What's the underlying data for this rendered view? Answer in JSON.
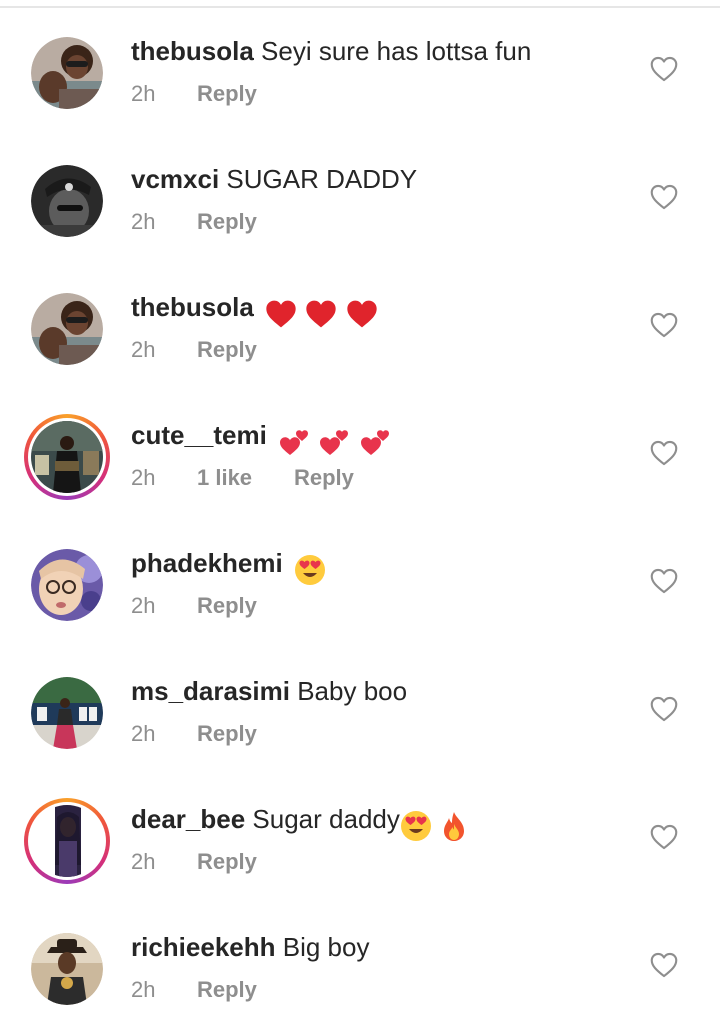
{
  "comments": [
    {
      "username": "thebusola",
      "text": "Seyi sure has lottsa fun",
      "time": "2h",
      "likes": "",
      "reply_label": "Reply",
      "has_story": false,
      "avatar": "avatar-woman-glasses",
      "emojis": []
    },
    {
      "username": "vcmxci",
      "text": "SUGAR DADDY",
      "time": "2h",
      "likes": "",
      "reply_label": "Reply",
      "has_story": false,
      "avatar": "avatar-man-cap-bw",
      "emojis": []
    },
    {
      "username": "thebusola",
      "text": "",
      "time": "2h",
      "likes": "",
      "reply_label": "Reply",
      "has_story": false,
      "avatar": "avatar-woman-glasses",
      "emojis": [
        "red-heart",
        "red-heart",
        "red-heart"
      ]
    },
    {
      "username": "cute__temi",
      "text": "",
      "time": "2h",
      "likes": "1 like",
      "reply_label": "Reply",
      "has_story": true,
      "avatar": "avatar-woman-standing",
      "emojis": [
        "two-hearts",
        "two-hearts",
        "two-hearts"
      ]
    },
    {
      "username": "phadekhemi",
      "text": "",
      "time": "2h",
      "likes": "",
      "reply_label": "Reply",
      "has_story": false,
      "avatar": "avatar-woman-selfie",
      "emojis": [
        "heart-eyes"
      ]
    },
    {
      "username": "ms_darasimi",
      "text": "Baby boo",
      "time": "2h",
      "likes": "",
      "reply_label": "Reply",
      "has_story": false,
      "avatar": "avatar-woman-sign",
      "emojis": []
    },
    {
      "username": "dear_bee",
      "text": "Sugar daddy",
      "time": "2h",
      "likes": "",
      "reply_label": "Reply",
      "has_story": true,
      "avatar": "avatar-woman-portrait",
      "emojis": [
        "heart-eyes",
        "fire"
      ]
    },
    {
      "username": "richieekehh",
      "text": "Big boy",
      "time": "2h",
      "likes": "",
      "reply_label": "Reply",
      "has_story": false,
      "avatar": "avatar-man-hat",
      "emojis": []
    }
  ],
  "icons": {
    "like": "heart-outline-icon"
  },
  "colors": {
    "username": "#262626",
    "meta": "#8e8e8e",
    "heart_outline": "#8e8e8e",
    "story_ring": [
      "#f9a12a",
      "#f0573b",
      "#d42f7a",
      "#9b3bb8"
    ],
    "red_heart": "#e0242c",
    "two_hearts": "#e8344c",
    "heart_eyes_face": "#ffcb3d"
  }
}
